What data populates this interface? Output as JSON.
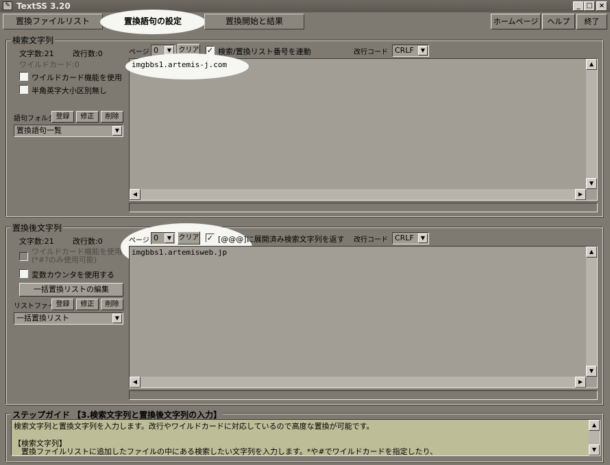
{
  "window": {
    "title": "TextSS 3.20",
    "icon": "app-icon",
    "controls": [
      "minimize-icon",
      "maximize-icon",
      "close-icon"
    ]
  },
  "tabs": [
    {
      "label": "置換ファイルリスト",
      "active": false
    },
    {
      "label": "置換語句の設定",
      "active": true
    },
    {
      "label": "置換開始と結果",
      "active": false
    }
  ],
  "top_buttons": {
    "home": "ホームページ",
    "help": "ヘルプ",
    "exit": "終了"
  },
  "search": {
    "legend": "検索文字列",
    "char_count": "文字数:21",
    "line_count": "改行数:0",
    "wildcard_count": "ワイルドカード:0",
    "wildcard_check": "ワイルドカード機能を使用",
    "wildcard_checked": false,
    "case_check": "半角英字大小区別無し",
    "case_checked": false,
    "folder_label": "語句フォルダ",
    "reg_btn": "登録",
    "mod_btn": "修正",
    "del_btn": "削除",
    "folder_select": "置換語句一覧",
    "page_label": "ページ",
    "page_value": "0",
    "clear_btn": "クリア",
    "link_check": "検索/置換リスト番号を連動",
    "link_checked": true,
    "newline_label": "改行コード",
    "newline_value": "CRLF",
    "text": "imgbbs1.artemis-j.com"
  },
  "replace": {
    "legend": "置換後文字列",
    "char_count": "文字数:21",
    "line_count": "改行数:0",
    "wildcard_check": "ワイルドカード機能を使用",
    "wildcard_check2": "(*#?のみ使用可能)",
    "wildcard_checked": false,
    "counter_check": "変数カウンタを使用する",
    "counter_checked": false,
    "bulk_edit_btn": "一括置換リストの編集",
    "list_label": "リストファイル",
    "reg_btn": "登録",
    "mod_btn": "修正",
    "del_btn": "削除",
    "list_select": "一括置換リスト",
    "page_label": "ページ",
    "page_value": "0",
    "clear_btn": "クリア",
    "expand_check": "[@@@]に展開済み検索文字列を返す",
    "expand_checked": true,
    "newline_label": "改行コード",
    "newline_value": "CRLF",
    "text": "imgbbs1.artemisweb.jp"
  },
  "guide": {
    "legend": "ステップガイド 【3.検索文字列と置換後文字列の入力】",
    "lines": [
      "検索文字列と置換文字列を入力します。改行やワイルドカードに対応しているので高度な置換が可能です。",
      "",
      "【検索文字列】",
      "　置換ファイルリストに追加したファイルの中にある検索したい文字列を入力します。*や#でワイルドカードを指定したり、"
    ]
  },
  "colors": {
    "background": "#7e7a71",
    "text_area": "#a29e95",
    "guide_area": "#bdbd98",
    "highlight": "#f6f6f2"
  }
}
